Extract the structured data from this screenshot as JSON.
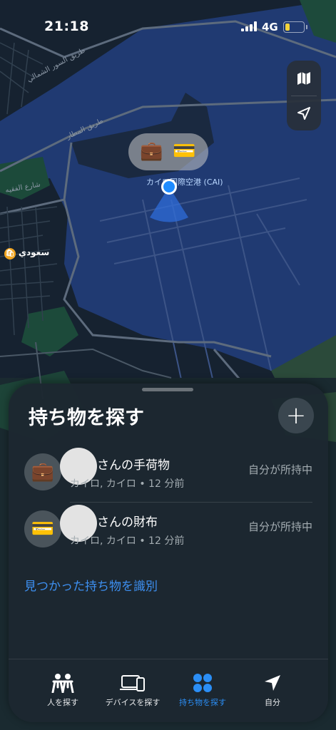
{
  "status_bar": {
    "time": "21:18",
    "network": "4G",
    "battery_level": 0.25,
    "battery_color": "#f3d33b"
  },
  "map": {
    "water_color": "#203a72",
    "land_color": "#162230",
    "airport_label": "カイロ国際空港 (CAI)",
    "poi_label": "سعودي",
    "street_labels": [
      "طريق المطار",
      "شارع الفقيه",
      "طريق السور الشمالي"
    ]
  },
  "map_controls": {
    "map_icon": "map-icon",
    "location_icon": "location-arrow-icon"
  },
  "annotation_pill": {
    "items": [
      "suitcase-icon",
      "wallet-card-icon"
    ]
  },
  "sheet": {
    "title": "持ち物を探す",
    "add_label": "+",
    "items": [
      {
        "name": "さんの手荷物",
        "subtitle": "カイロ, カイロ • 12 分前",
        "status": "自分が所持中",
        "icon": "suitcase-icon"
      },
      {
        "name": "さんの財布",
        "subtitle": "カイロ, カイロ • 12 分前",
        "status": "自分が所持中",
        "icon": "wallet-card-icon"
      }
    ],
    "identify_link": "見つかった持ち物を識別"
  },
  "tabbar": {
    "tabs": [
      {
        "label": "人を探す",
        "icon": "people-icon",
        "active": false
      },
      {
        "label": "デバイスを探す",
        "icon": "devices-icon",
        "active": false
      },
      {
        "label": "持ち物を探す",
        "icon": "items-grid-icon",
        "active": true
      },
      {
        "label": "自分",
        "icon": "location-arrow-icon",
        "active": false
      }
    ],
    "active_color": "#2b8ef5"
  }
}
